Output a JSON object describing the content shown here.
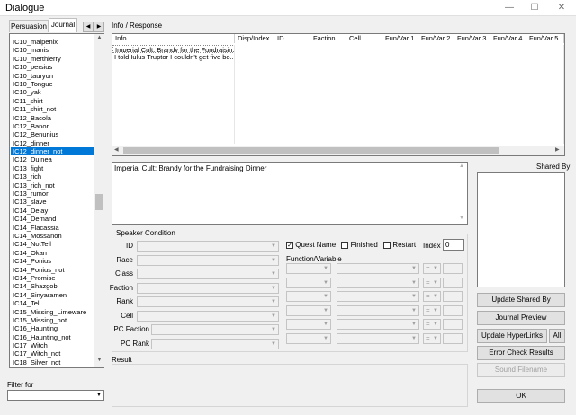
{
  "window": {
    "title": "Dialogue",
    "minimize_glyph": "—",
    "maximize_glyph": "☐",
    "close_glyph": "✕"
  },
  "tabs": [
    {
      "label": "Persuasion"
    },
    {
      "label": "Journal"
    }
  ],
  "tab_nav": {
    "left_glyph": "◀",
    "right_glyph": "▶"
  },
  "topic_list": {
    "items": [
      "IC10_malpenix",
      "IC10_manis",
      "IC10_merthierry",
      "IC10_persius",
      "IC10_tauryon",
      "IC10_Tongue",
      "IC10_yak",
      "IC11_shirt",
      "IC11_shirt_not",
      "IC12_Bacola",
      "IC12_Banor",
      "IC12_Benunius",
      "IC12_dinner",
      "IC12_dinner_not",
      "IC12_Dulnea",
      "IC13_fight",
      "IC13_rich",
      "IC13_rich_not",
      "IC13_rumor",
      "IC13_slave",
      "IC14_Delay",
      "IC14_Demand",
      "IC14_Flacassia",
      "IC14_Mossanon",
      "IC14_NotTell",
      "IC14_Okan",
      "IC14_Ponius",
      "IC14_Ponius_not",
      "IC14_Promise",
      "IC14_Shazgob",
      "IC14_Sinyaramen",
      "IC14_Tell",
      "IC15_Missing_Limeware",
      "IC15_Missing_not",
      "IC16_Haunting",
      "IC16_Haunting_not",
      "IC17_Witch",
      "IC17_Witch_not",
      "IC18_Silver_not"
    ],
    "selected_index": 13
  },
  "filter": {
    "label": "Filter for",
    "value": ""
  },
  "info_response": {
    "label": "Info / Response",
    "columns": [
      "Info",
      "Disp/Index",
      "ID",
      "Faction",
      "Cell",
      "Fun/Var 1",
      "Fun/Var 2",
      "Fun/Var 3",
      "Fun/Var 4",
      "Fun/Var 5"
    ],
    "rows": [
      {
        "info": "Imperial Cult: Brandy for the Fundraisin..."
      },
      {
        "info": "I told Iulus Truptor I couldn't get five bo..."
      }
    ],
    "selected_row": 0
  },
  "response_text": "Imperial Cult: Brandy for the Fundraising Dinner",
  "speaker_condition": {
    "title": "Speaker Condition",
    "fields": [
      "ID",
      "Race",
      "Class",
      "Faction",
      "Rank",
      "Cell",
      "PC Faction",
      "PC Rank"
    ]
  },
  "quest_flags": {
    "quest_name": {
      "label": "Quest Name",
      "checked": true
    },
    "finished": {
      "label": "Finished",
      "checked": false
    },
    "restart": {
      "label": "Restart",
      "checked": false
    },
    "index_label": "Index",
    "index_value": "0",
    "check_glyph": "✓"
  },
  "function_variable": {
    "label": "Function/Variable",
    "rows": 6,
    "op_placeholder": "="
  },
  "result": {
    "label": "Result"
  },
  "shared_by": {
    "label": "Shared By"
  },
  "buttons": {
    "update_shared_by": "Update Shared By",
    "journal_preview": "Journal Preview",
    "update_hyperlinks": "Update HyperLinks",
    "all": "All",
    "error_check_results": "Error Check Results",
    "sound_filename": "Sound Filename",
    "ok": "OK"
  },
  "glyphs": {
    "up": "▲",
    "down": "▼",
    "left": "◀",
    "right": "▶",
    "combo": "▼"
  }
}
